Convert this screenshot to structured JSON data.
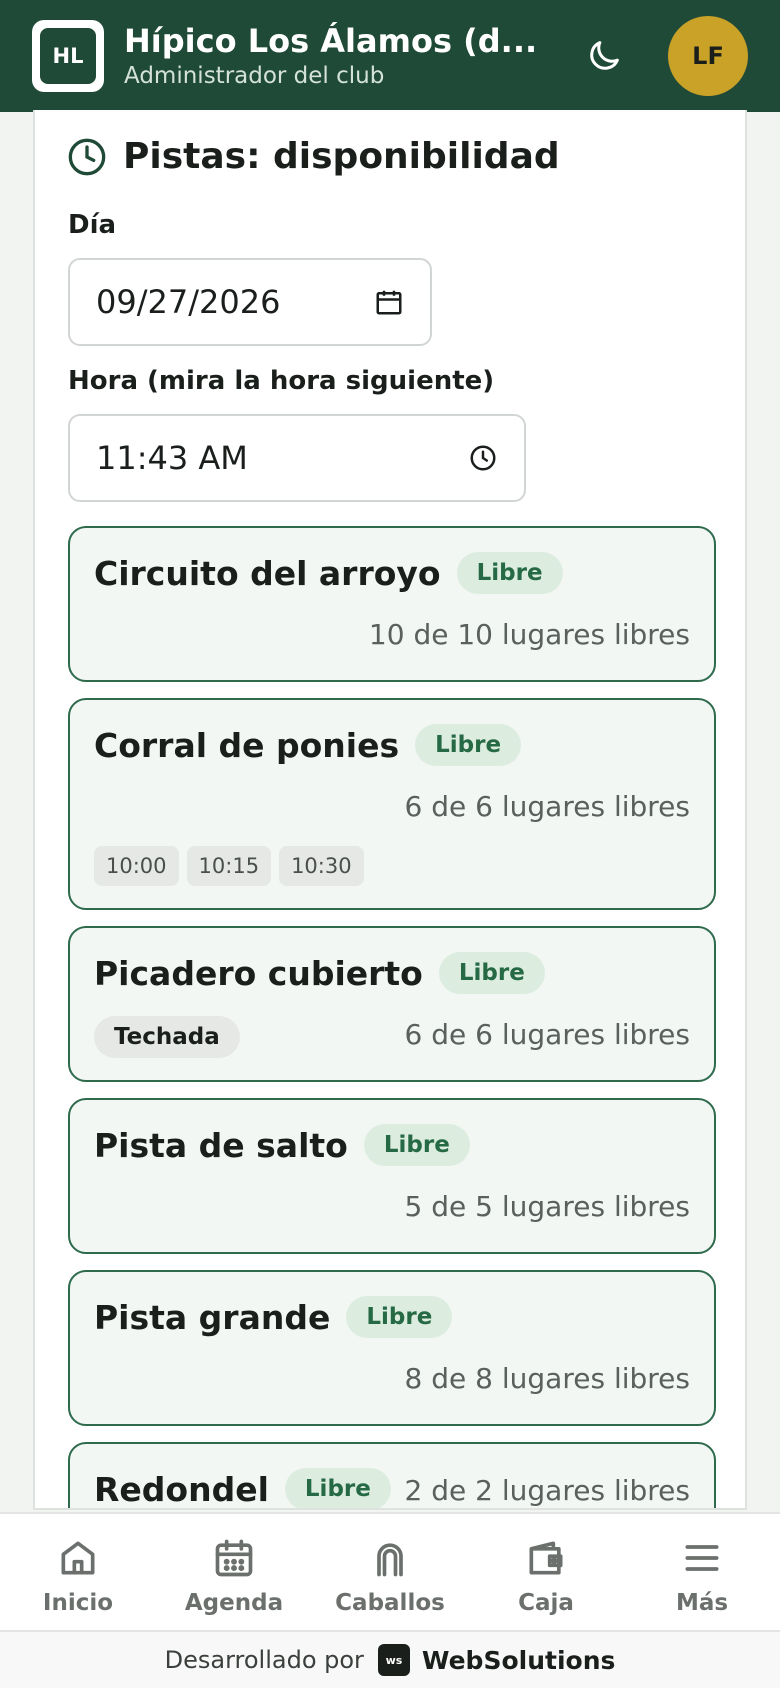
{
  "header": {
    "logo_initials": "HL",
    "title": "Hípico Los Álamos (d...",
    "subtitle": "Administrador del club",
    "avatar_initials": "LF"
  },
  "panel": {
    "title": "Pistas: disponibilidad",
    "day_label": "Día",
    "day_value": "09/27/2026",
    "time_label": "Hora (mira la hora siguiente)",
    "time_value": "11:43 AM"
  },
  "pistas": [
    {
      "name": "Circuito del arroyo",
      "status": "Libre",
      "spots": "10 de 10 lugares libres"
    },
    {
      "name": "Corral de ponies",
      "status": "Libre",
      "spots": "6 de 6 lugares libres",
      "slots": [
        "10:00",
        "10:15",
        "10:30"
      ]
    },
    {
      "name": "Picadero cubierto",
      "status": "Libre",
      "spots": "6 de 6 lugares libres",
      "tag": "Techada"
    },
    {
      "name": "Pista de salto",
      "status": "Libre",
      "spots": "5 de 5 lugares libres"
    },
    {
      "name": "Pista grande",
      "status": "Libre",
      "spots": "8 de 8 lugares libres"
    },
    {
      "name": "Redondel",
      "status": "Libre",
      "spots": "2 de 2 lugares libres"
    }
  ],
  "nav": [
    {
      "label": "Inicio",
      "icon": "home-icon"
    },
    {
      "label": "Agenda",
      "icon": "calendar-icon"
    },
    {
      "label": "Caballos",
      "icon": "horseshoe-icon"
    },
    {
      "label": "Caja",
      "icon": "wallet-icon"
    },
    {
      "label": "Más",
      "icon": "menu-icon"
    }
  ],
  "footer": {
    "prefix": "Desarrollado por",
    "brand_mark": "ws",
    "brand": "WebSolutions"
  },
  "colors": {
    "header_bg": "#1f4a37",
    "avatar_bg": "#c9a227",
    "accent_green": "#2e6a4c",
    "badge_bg": "#dcecdf"
  }
}
